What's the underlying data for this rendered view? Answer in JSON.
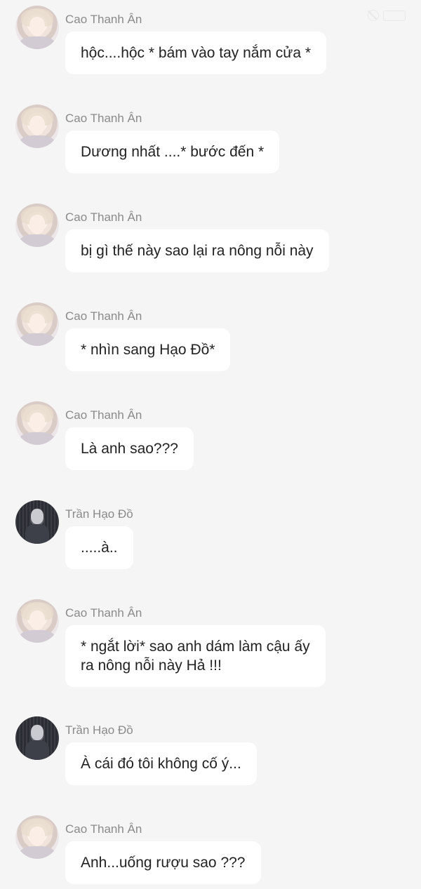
{
  "messages": [
    {
      "sender": "Cao Thanh Ân",
      "text": "hộc....hộc * bám vào tay nắm cửa *"
    },
    {
      "sender": "Cao Thanh Ân",
      "text": "Dương nhất ....* bước đến *"
    },
    {
      "sender": "Cao Thanh Ân",
      "text": "bị gì thế này sao lại ra nông nỗi này"
    },
    {
      "sender": "Cao Thanh Ân",
      "text": "* nhìn sang Hạo Đồ*"
    },
    {
      "sender": "Cao Thanh Ân",
      "text": "Là anh sao???"
    },
    {
      "sender": "Trần Hạo Đồ",
      "text": ".....à.."
    },
    {
      "sender": "Cao Thanh Ân",
      "text": "* ngắt lời* sao anh dám làm cậu ấy\nra nông nỗi này Hả !!!"
    },
    {
      "sender": "Trần Hạo Đồ",
      "text": "À cái đó tôi không cố ý..."
    },
    {
      "sender": "Cao Thanh Ân",
      "text": "Anh...uống rượu sao ???"
    }
  ]
}
